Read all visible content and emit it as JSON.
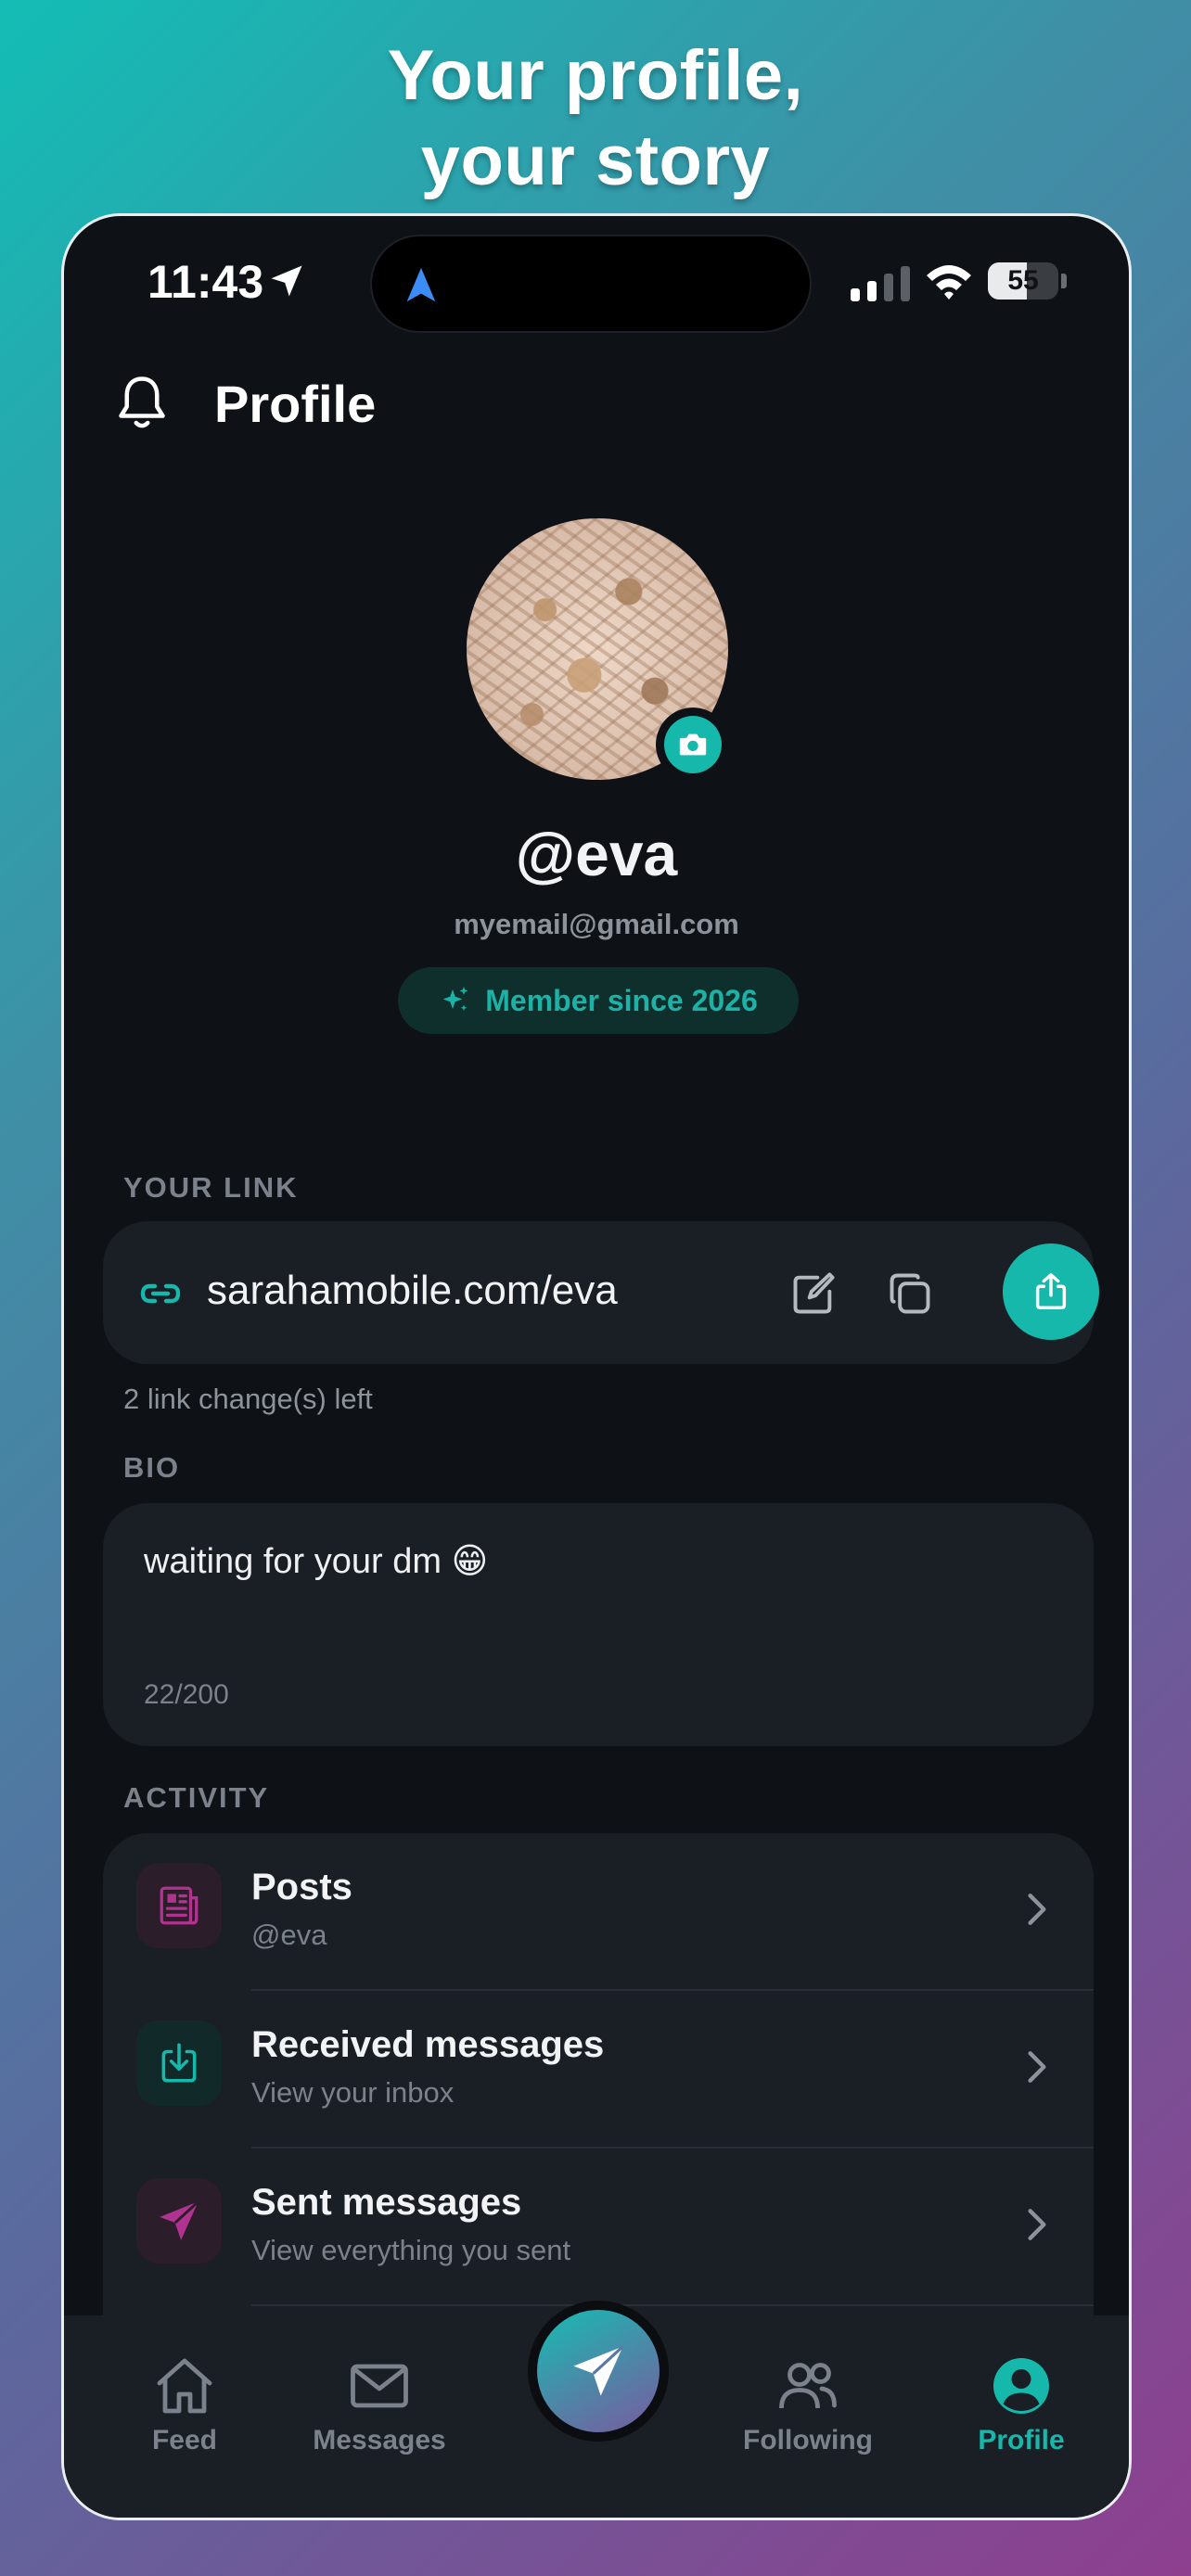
{
  "headline": {
    "line1": "Your profile,",
    "line2": "your story"
  },
  "status_bar": {
    "time": "11:43",
    "battery_percent": "55",
    "battery_level": 0.55
  },
  "header": {
    "title": "Profile"
  },
  "profile": {
    "username": "@eva",
    "email": "myemail@gmail.com",
    "member_badge": "Member since 2026"
  },
  "link_section": {
    "label": "YOUR LINK",
    "url": "sarahamobile.com/eva",
    "changes_left": "2 link change(s) left"
  },
  "bio_section": {
    "label": "BIO",
    "text": "waiting for your dm 😁",
    "counter": "22/200"
  },
  "activity": {
    "label": "ACTIVITY",
    "items": [
      {
        "title": "Posts",
        "subtitle": "@eva",
        "icon": "newspaper-icon",
        "color": "#b0338f"
      },
      {
        "title": "Received messages",
        "subtitle": "View your inbox",
        "icon": "inbox-download-icon",
        "color": "#17b8ac"
      },
      {
        "title": "Sent messages",
        "subtitle": "View everything you sent",
        "icon": "paper-plane-icon",
        "color": "#b0338f"
      }
    ]
  },
  "tabbar": {
    "items": [
      {
        "label": "Feed",
        "icon": "home-icon"
      },
      {
        "label": "Messages",
        "icon": "envelope-icon"
      },
      {
        "label": "Following",
        "icon": "people-icon"
      },
      {
        "label": "Profile",
        "icon": "user-circle-icon",
        "active": true
      }
    ],
    "fab_icon": "paper-plane-icon"
  },
  "colors": {
    "accent": "#17b8ac",
    "background": "#0e1116",
    "card": "#1a1e25",
    "secondary_text": "#7b828b"
  }
}
